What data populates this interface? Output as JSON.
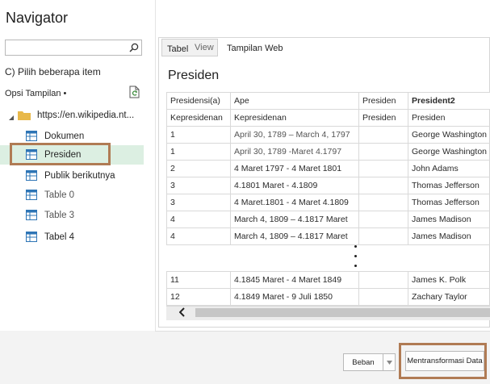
{
  "window": {
    "title": "Navigator"
  },
  "search": {
    "placeholder": ""
  },
  "left": {
    "multi_select": "C) Pilih beberapa item",
    "options_label": "Opsi Tampilan •",
    "root_label": "https://en.wikipedia.nt...",
    "items": [
      {
        "label": "Dokumen"
      },
      {
        "label": "Presiden"
      },
      {
        "label": "Publik berikutnya"
      },
      {
        "label": "Table 0"
      },
      {
        "label": "Table 3"
      },
      {
        "label": "Tabel 4"
      }
    ]
  },
  "tabs": {
    "table_view": "Tabel",
    "table_view_overlay": "View",
    "web_view": "Tampilan Web"
  },
  "preview": {
    "title": "Presiden",
    "headers": [
      "Presidensi(a)",
      "Ape",
      "Presiden",
      "President2"
    ],
    "subheaders": [
      "Kepresidenan",
      "Kepresidenan",
      "Presiden",
      "Presiden"
    ],
    "rows": [
      [
        "1",
        "April 30, 1789 – March 4, 1797",
        "",
        "George Washington"
      ],
      [
        "1",
        "April 30, 1789 -Maret 4.1797",
        "",
        "George Washington"
      ],
      [
        "2",
        "4 Maret 1797 -   4 Maret 1801",
        "",
        "John Adams"
      ],
      [
        "3",
        "4.1801 Maret -      4.1809",
        "",
        "Thomas Jefferson"
      ],
      [
        "3",
        "4 Maret.1801 - 4 Maret 4.1809",
        "",
        "Thomas Jefferson"
      ],
      [
        "4",
        "March 4, 1809 – 4.1817 Maret",
        "",
        "James Madison"
      ],
      [
        "4",
        "March 4, 1809 – 4.1817 Maret",
        "",
        "James Madison"
      ]
    ],
    "rows_bottom": [
      [
        "11",
        "4.1845 Maret -   4 Maret 1849",
        "",
        "James K. Polk"
      ],
      [
        "12",
        "4.1849 Maret - 9 Juli 1850",
        "",
        "Zachary  Taylor"
      ]
    ]
  },
  "footer": {
    "load_label": "Beban",
    "transform_label": "Mentransformasi Data"
  },
  "colors": {
    "selection": "#dcefe2",
    "highlight_border": "#b07b54"
  }
}
